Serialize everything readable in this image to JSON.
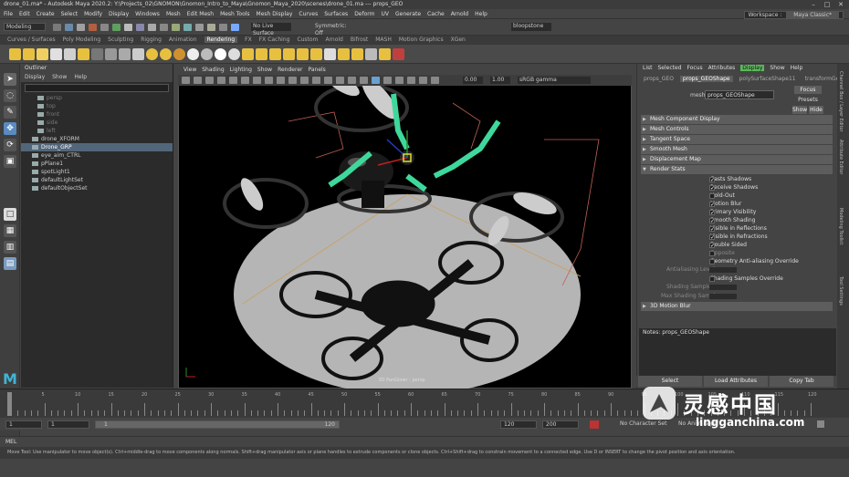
{
  "window_title": "drone_01.ma* - Autodesk Maya 2020.2: Y:\\Projects_02\\GNOMON\\Gnomon_Intro_to_Maya\\Gnomon_Maya_2020\\scenes\\drone_01.ma --- props_GEO",
  "menu": [
    "File",
    "Edit",
    "Create",
    "Select",
    "Modify",
    "Display",
    "Windows",
    "Mesh",
    "Edit Mesh",
    "Mesh Tools",
    "Mesh Display",
    "Curves",
    "Surfaces",
    "Deform",
    "UV",
    "Generate",
    "Cache",
    "Arnold",
    "Help"
  ],
  "workspace": {
    "label": "Workspace :",
    "value": "Maya Classic*"
  },
  "status": {
    "mode": "Modeling",
    "live_surface": "No Live Surface",
    "symmetry": "Symmetric: Off",
    "camera": "bloopstone"
  },
  "shelf_tabs": [
    "Curves / Surfaces",
    "Poly Modeling",
    "Sculpting",
    "Rigging",
    "Animation",
    "Rendering",
    "FX",
    "FX Caching",
    "Custom",
    "Arnold",
    "Bifrost",
    "MASH",
    "Motion Graphics",
    "XGen"
  ],
  "active_shelf": "Rendering",
  "outliner": {
    "title": "Outliner",
    "menu": [
      "Display",
      "Show",
      "Help"
    ],
    "items": [
      {
        "label": "persp",
        "dim": true
      },
      {
        "label": "top",
        "dim": true
      },
      {
        "label": "front",
        "dim": true
      },
      {
        "label": "side",
        "dim": true
      },
      {
        "label": "left",
        "dim": true
      },
      {
        "label": "drone_XFORM",
        "dim": false
      },
      {
        "label": "Drone_GRP",
        "dim": false,
        "selected": true
      },
      {
        "label": "eye_aim_CTRL",
        "dim": false
      },
      {
        "label": "pPlane1",
        "dim": false
      },
      {
        "label": "spotLight1",
        "dim": false
      },
      {
        "label": "defaultLightSet",
        "dim": false
      },
      {
        "label": "defaultObjectSet",
        "dim": false
      }
    ]
  },
  "viewport": {
    "menu": [
      "View",
      "Shading",
      "Lighting",
      "Show",
      "Renderer",
      "Panels"
    ],
    "field1": "0.00",
    "field2": "1.00",
    "colorspace": "sRGB gamma",
    "label": "3D PanGlowr : persp"
  },
  "attribute_editor": {
    "menu": [
      "List",
      "Selected",
      "Focus",
      "Attributes",
      "Display",
      "Show",
      "Help"
    ],
    "highlighted_menu": "Display",
    "tabs": [
      "props_GEO",
      "props_GEOShape",
      "polySurfaceShape11",
      "transformGeome"
    ],
    "active_tab": "props_GEOShape",
    "mesh_label": "mesh:",
    "mesh_value": "props_GEOShape",
    "focus_btn": "Focus",
    "presets_btn": "Presets",
    "show_btn": "Show",
    "hide_btn": "Hide",
    "sections": [
      "Mesh Component Display",
      "Mesh Controls",
      "Tangent Space",
      "Smooth Mesh",
      "Displacement Map",
      "Render Stats"
    ],
    "checkboxes": [
      {
        "label": "Casts Shadows",
        "checked": true
      },
      {
        "label": "Receive Shadows",
        "checked": true
      },
      {
        "label": "Hold-Out",
        "checked": false
      },
      {
        "label": "Motion Blur",
        "checked": true
      },
      {
        "label": "Primary Visibility",
        "checked": true
      },
      {
        "label": "Smooth Shading",
        "checked": true
      },
      {
        "label": "Visible in Reflections",
        "checked": true
      },
      {
        "label": "Visible in Refractions",
        "checked": true
      },
      {
        "label": "Double Sided",
        "checked": true
      },
      {
        "label": "Opposite",
        "checked": false,
        "dim": true
      },
      {
        "label": "Geometry Anti-aliasing Override",
        "checked": false
      }
    ],
    "antialias_label": "Antialiasing Level",
    "shading_override": "Shading Samples Override",
    "shading_samples": "Shading Samples",
    "max_shading": "Max Shading Samples",
    "motion_blur_section": "3D Motion Blur",
    "notes": "Notes: props_GEOShape",
    "btn_select": "Select",
    "btn_load": "Load Attributes",
    "btn_copy": "Copy Tab"
  },
  "side_tabs": [
    "Channel Box / Layer Editor",
    "Attribute Editor",
    "Modeling Toolkit",
    "Tool Settings"
  ],
  "timeline": {
    "ticks": [
      "5",
      "10",
      "15",
      "20",
      "25",
      "30",
      "35",
      "40",
      "45",
      "50",
      "55",
      "60",
      "65",
      "70",
      "75",
      "80",
      "85",
      "90",
      "95",
      "100",
      "105",
      "110",
      "115",
      "120"
    ],
    "start": "1",
    "current": "1",
    "range_start": "1",
    "range_end": "120",
    "end": "120",
    "anim_end": "200",
    "char_set": "No Character Set",
    "anim_layer": "No Anim Layer"
  },
  "cmd_label": "MEL",
  "help_line": "Move Tool: Use manipulator to move object(s). Ctrl+middle-drag to move components along normals. Shift+drag manipulator axis or plane handles to extrude components or clone objects. Ctrl+Shift+drag to constrain movement to a connected edge. Use D or INSERT to change the pivot position and axis orientation.",
  "watermark": {
    "logo": "灵感中国",
    "url": "lingganchina.com"
  }
}
